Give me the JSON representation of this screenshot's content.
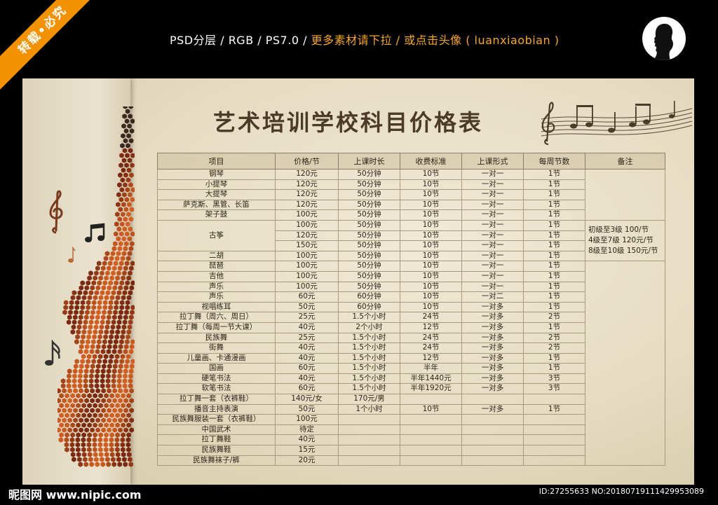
{
  "watermark": {
    "ribbon_text": "转载•必究"
  },
  "header": {
    "info_prefix": "PSD分层 / RGB / PS7.0 / ",
    "info_accent": "更多素材请下拉 / 或点击头像 ( luanxiaobian )"
  },
  "poster": {
    "title": "艺术培训学校科目价格表"
  },
  "table": {
    "headers": [
      "项目",
      "价格/节",
      "上课时长",
      "收费标准",
      "上课形式",
      "每周节数",
      "备注"
    ],
    "note_lines": [
      "初级至3级 100/节",
      "4级至7级 120元/节",
      "8级至10级 150元/节"
    ],
    "rows": [
      [
        "钢琴",
        "120元",
        "50分钟",
        "10节",
        "一对一",
        "1节"
      ],
      [
        "小提琴",
        "120元",
        "50分钟",
        "10节",
        "一对一",
        "1节"
      ],
      [
        "大提琴",
        "120元",
        "50分钟",
        "10节",
        "一对一",
        "1节"
      ],
      [
        "萨克斯、黑管、长笛",
        "120元",
        "50分钟",
        "10节",
        "一对一",
        "1节"
      ],
      [
        "架子鼓",
        "100元",
        "50分钟",
        "10节",
        "一对一",
        "1节"
      ],
      [
        "古筝",
        "100元",
        "50分钟",
        "10节",
        "一对一",
        "1节"
      ],
      [
        "",
        "120元",
        "50分钟",
        "10节",
        "一对一",
        "1节"
      ],
      [
        "",
        "150元",
        "50分钟",
        "10节",
        "一对一",
        "1节"
      ],
      [
        "二胡",
        "100元",
        "50分钟",
        "10节",
        "一对一",
        "1节"
      ],
      [
        "琵琶",
        "100元",
        "50分钟",
        "10节",
        "一对一",
        "1节"
      ],
      [
        "吉他",
        "100元",
        "50分钟",
        "10节",
        "一对一",
        "1节"
      ],
      [
        "声乐",
        "100元",
        "50分钟",
        "10节",
        "一对一",
        "1节"
      ],
      [
        "声乐",
        "60元",
        "60分钟",
        "10节",
        "一对二",
        "1节"
      ],
      [
        "视唱练耳",
        "50元",
        "60分钟",
        "10节",
        "一对多",
        "1节"
      ],
      [
        "拉丁舞（周六、周日）",
        "25元",
        "1.5个小时",
        "24节",
        "一对多",
        "2节"
      ],
      [
        "拉丁舞（每周一节大课）",
        "40元",
        "2个小时",
        "12节",
        "一对多",
        "1节"
      ],
      [
        "民族舞",
        "25元",
        "1.5个小时",
        "24节",
        "一对多",
        "2节"
      ],
      [
        "街舞",
        "40元",
        "1.5个小时",
        "24节",
        "一对多",
        "2节"
      ],
      [
        "儿童画、卡通漫画",
        "40元",
        "1.5个小时",
        "12节",
        "一对多",
        "1节"
      ],
      [
        "国画",
        "60元",
        "1.5个小时",
        "半年",
        "一对多",
        "1节"
      ],
      [
        "硬笔书法",
        "40元",
        "1.5个小时",
        "半年1440元",
        "一对多",
        "3节"
      ],
      [
        "软笔书法",
        "60元",
        "1.5个小时",
        "半年1920元",
        "一对多",
        "3节"
      ],
      [
        "拉丁舞一套（衣裤鞋）",
        "140元/女",
        "170元/男",
        "",
        "",
        ""
      ],
      [
        "播音主持表演",
        "50元",
        "1个小时",
        "10节",
        "一对多",
        "1节"
      ],
      [
        "民族舞服装一套（衣裤鞋）",
        "100元",
        "",
        "",
        "",
        ""
      ],
      [
        "中国武术",
        "待定",
        "",
        "",
        "",
        ""
      ],
      [
        "拉丁舞鞋",
        "40元",
        "",
        "",
        "",
        ""
      ],
      [
        "民族舞鞋",
        "15元",
        "",
        "",
        "",
        ""
      ],
      [
        "民族舞袜子/裤",
        "20元",
        "",
        "",
        "",
        ""
      ]
    ]
  },
  "footer": {
    "site": "昵图网 www.nipic.com",
    "id_info": "ID:27255633 NO:20180719111429953089"
  },
  "icons": [
    "treble-clef-icon",
    "eighth-note-icon",
    "silhouette-avatar-icon"
  ]
}
